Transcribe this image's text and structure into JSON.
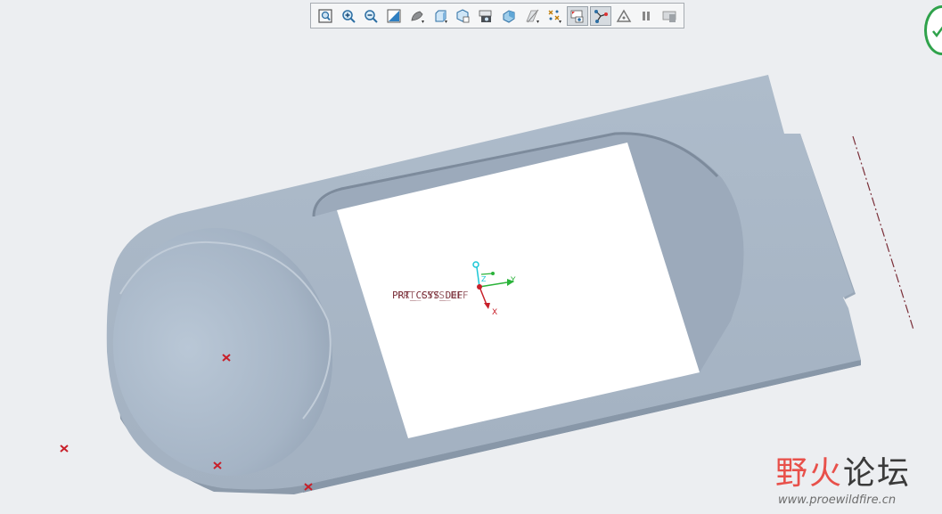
{
  "toolbar": {
    "buttons": [
      {
        "name": "refit-button",
        "icon": "refit-icon"
      },
      {
        "name": "zoom-in-button",
        "icon": "zoom-in-icon"
      },
      {
        "name": "zoom-out-button",
        "icon": "zoom-out-icon"
      },
      {
        "name": "repaint-button",
        "icon": "repaint-icon"
      },
      {
        "name": "display-style-button",
        "icon": "display-style-icon"
      },
      {
        "name": "saved-orientations-button",
        "icon": "saved-orientations-icon"
      },
      {
        "name": "view-manager-button",
        "icon": "view-manager-icon"
      },
      {
        "name": "perspective-view-button",
        "icon": "perspective-view-icon"
      },
      {
        "name": "section-button",
        "icon": "section-icon"
      },
      {
        "name": "datum-display-button",
        "icon": "datum-display-icon"
      },
      {
        "name": "annotation-display-button",
        "icon": "annotation-display-icon"
      },
      {
        "name": "spin-center-button",
        "icon": "spin-center-icon",
        "active": true
      },
      {
        "name": "model-tree-connect-button",
        "icon": "connect-icon",
        "active": true
      },
      {
        "name": "show-triangle-button",
        "icon": "triangle-icon"
      },
      {
        "name": "pause-button",
        "icon": "pause-icon"
      },
      {
        "name": "regenerate-button",
        "icon": "regenerate-icon"
      }
    ]
  },
  "viewport": {
    "csys_label": "PRT_CSYS_DEF",
    "axis_x": "X",
    "axis_y": "Y",
    "axis_z": "Z"
  },
  "colors": {
    "background": "#eceef1",
    "model": "#a9b7c7",
    "model_shadow": "#8e9cac",
    "datum_point": "#c8202a",
    "axis_green": "#2bb33a",
    "axis_cyan": "#1cc7d6",
    "axis_red": "#c8202a"
  },
  "watermark": {
    "brand_part1": "野火",
    "brand_part2": "论坛",
    "url": "www.proewildfire.cn"
  }
}
